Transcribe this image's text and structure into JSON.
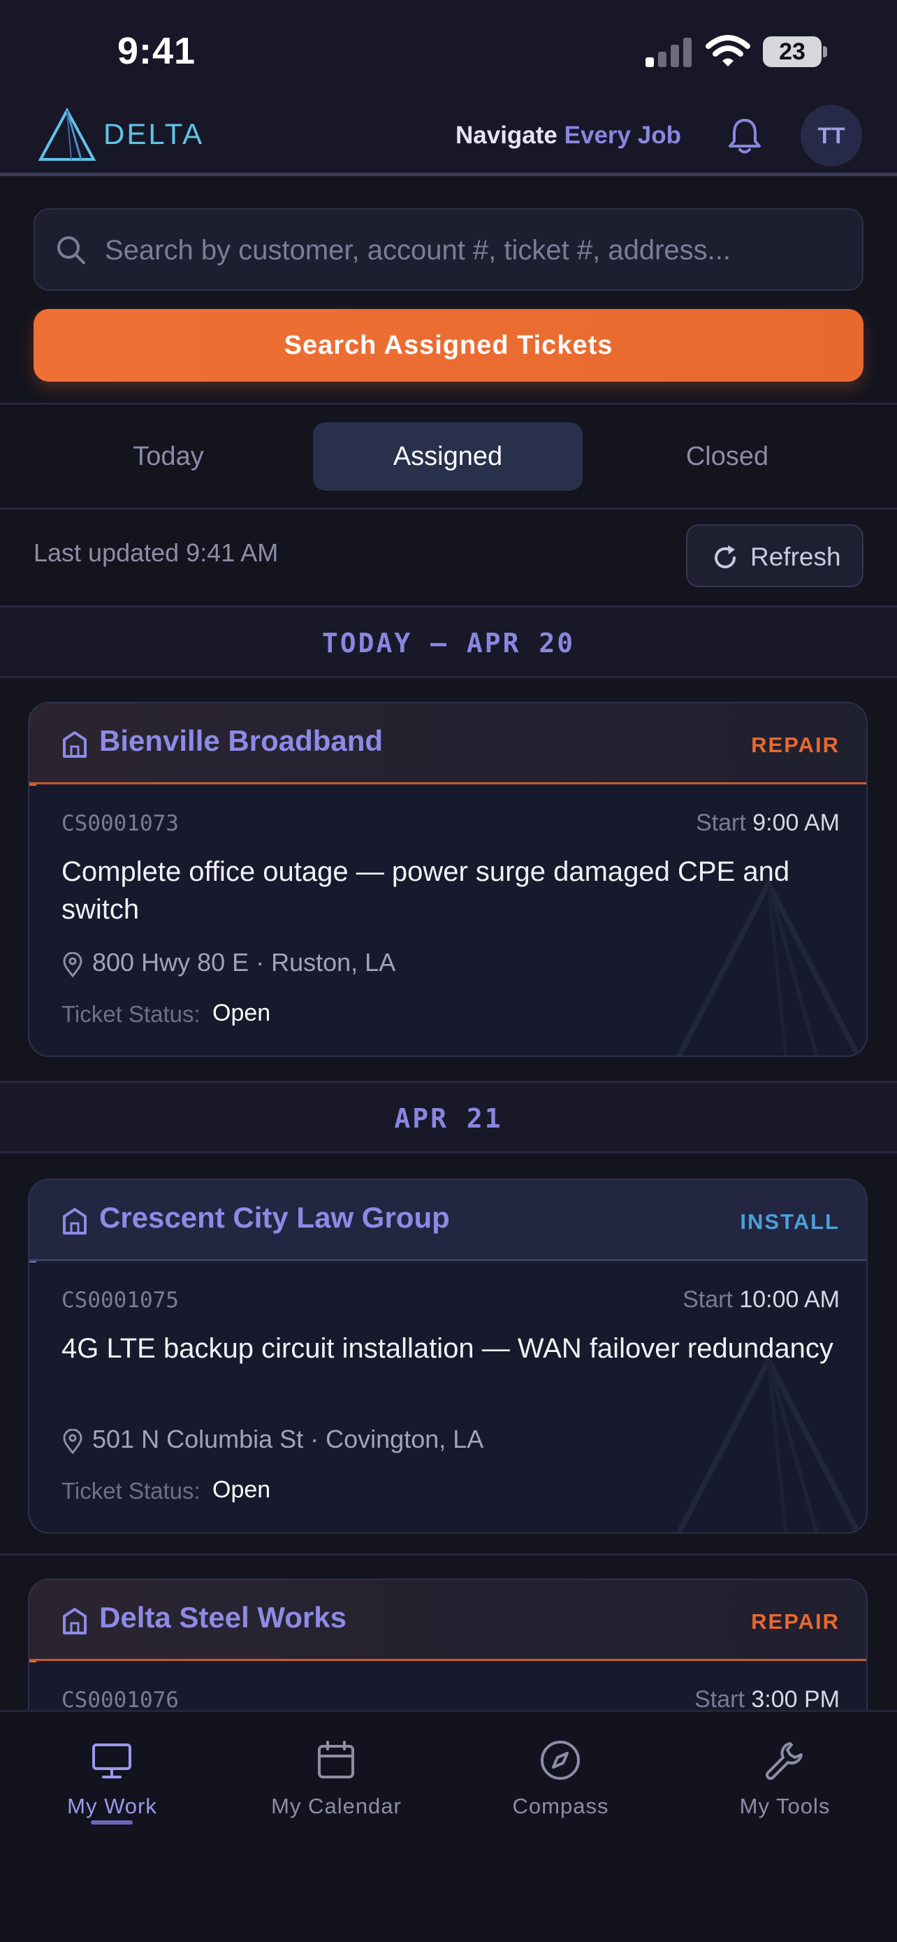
{
  "status_bar": {
    "time": "9:41",
    "battery": "23"
  },
  "header": {
    "logo_text": "DELTA",
    "tagline_primary": "Navigate",
    "tagline_accent": "Every Job",
    "avatar_initials": "TT"
  },
  "search": {
    "placeholder": "Search by customer, account #, ticket #, address...",
    "value": "",
    "button_label": "Search Assigned Tickets"
  },
  "tabs": [
    {
      "label": "Today",
      "active": false
    },
    {
      "label": "Assigned",
      "active": true
    },
    {
      "label": "Closed",
      "active": false
    }
  ],
  "last_updated": "Last updated 9:41 AM",
  "refresh_label": "Refresh",
  "groups": [
    {
      "date_label": "TODAY — APR 20",
      "tickets": [
        {
          "customer": "Bienville Broadband",
          "type": "REPAIR",
          "ticket_number": "CS0001073",
          "start_label": "Start",
          "start_time": "9:00 AM",
          "summary": "Complete office outage — power surge damaged CPE and switch",
          "address": "800 Hwy 80 E · Ruston, LA",
          "status_label": "Ticket Status:",
          "status": "Open"
        }
      ]
    },
    {
      "date_label": "APR 21",
      "tickets": [
        {
          "customer": "Crescent City Law Group",
          "type": "INSTALL",
          "ticket_number": "CS0001075",
          "start_label": "Start",
          "start_time": "10:00 AM",
          "summary": "4G LTE backup circuit installation — WAN failover redundancy",
          "address": "501 N Columbia St · Covington, LA",
          "status_label": "Ticket Status:",
          "status": "Open"
        },
        {
          "customer": "Delta Steel Works",
          "type": "REPAIR",
          "ticket_number": "CS0001076",
          "start_label": "Start",
          "start_time": "3:00 PM"
        }
      ]
    }
  ],
  "bottom_nav": [
    {
      "label": "My Work",
      "icon": "monitor-icon",
      "active": true
    },
    {
      "label": "My Calendar",
      "icon": "calendar-icon",
      "active": false
    },
    {
      "label": "Compass",
      "icon": "compass-icon",
      "active": false
    },
    {
      "label": "My Tools",
      "icon": "wrench-icon",
      "active": false
    }
  ],
  "colors": {
    "repair": "#e8692e",
    "install": "#4aa0d8",
    "accent": "#8a86e0",
    "background": "#14141f"
  }
}
